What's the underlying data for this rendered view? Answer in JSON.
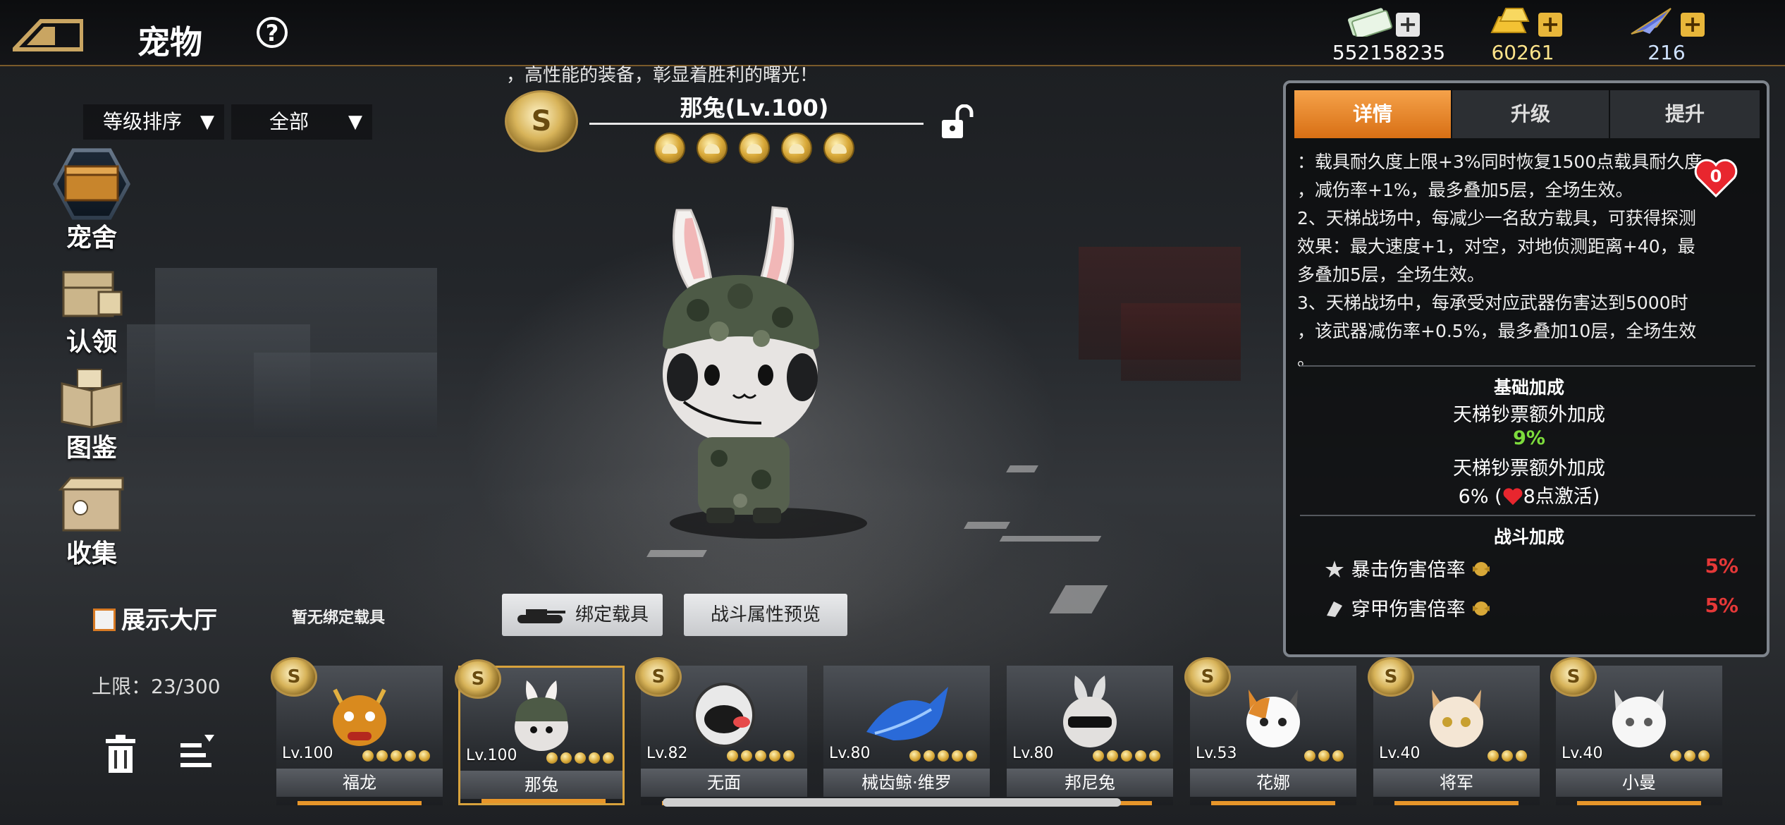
{
  "header": {
    "title": "宠物",
    "help_symbol": "?",
    "currencies": [
      {
        "icon": "cash-icon",
        "value": "552158235"
      },
      {
        "icon": "gold-bar-icon",
        "value": "60261"
      },
      {
        "icon": "fighter-jet-icon",
        "value": "216"
      }
    ],
    "plus_symbol": "+"
  },
  "filters": {
    "sort_label": "等级排序",
    "category_label": "全部",
    "arrow": "▼"
  },
  "sidenav": [
    {
      "label": "宠舍",
      "icon": "kennel-icon"
    },
    {
      "label": "认领",
      "icon": "claim-crate-icon"
    },
    {
      "label": "图鉴",
      "icon": "book-icon"
    },
    {
      "label": "收集",
      "icon": "collection-box-icon"
    }
  ],
  "pet": {
    "description": "，高性能的装备，彰显着胜利的曙光！",
    "name": "那兔(Lv.100)",
    "rank_symbol": "S",
    "stars": 5
  },
  "panel": {
    "tabs": [
      "详情",
      "升级",
      "提升"
    ],
    "heart_count": "0",
    "skill_lines": [
      "：载具耐久度上限+3%同时恢复1500点载具耐久度",
      "，减伤率+1%，最多叠加5层，全场生效。",
      "2、天梯战场中，每减少一名敌方载具，可获得探测",
      "效果：最大速度+1，对空，对地侦测距离+40，最",
      "多叠加5层，全场生效。",
      "3、天梯战场中，每承受对应武器伤害达到5000时",
      "，该武器减伤率+0.5%，最多叠加10层，全场生效",
      "。"
    ],
    "base_bonus": {
      "title": "基础加成",
      "line1_label": "天梯钞票额外加成",
      "line1_value": "9%",
      "line2_label": "天梯钞票额外加成",
      "line2_value": "6% (",
      "line2_suffix": "8点激活)"
    },
    "combat_bonus": {
      "title": "战斗加成",
      "rows": [
        {
          "label": "暴击伤害倍率",
          "value": "5%"
        },
        {
          "label": "穿甲伤害倍率",
          "value": "5%"
        }
      ]
    }
  },
  "actions": {
    "no_vehicle": "暂无绑定载具",
    "bind_vehicle": "绑定载具",
    "preview": "战斗属性预览",
    "showroom": "展示大厅",
    "limit": "上限：23/300"
  },
  "pets": [
    {
      "name": "福龙",
      "level": "Lv.100",
      "stars": 5,
      "selected": false,
      "medal": "S"
    },
    {
      "name": "那兔",
      "level": "Lv.100",
      "stars": 5,
      "selected": true,
      "medal": "S"
    },
    {
      "name": "无面",
      "level": "Lv.82",
      "stars": 5,
      "selected": false,
      "medal": "S"
    },
    {
      "name": "械齿鲸·维罗",
      "level": "Lv.80",
      "stars": 5,
      "selected": false,
      "medal": ""
    },
    {
      "name": "邦尼兔",
      "level": "Lv.80",
      "stars": 5,
      "selected": false,
      "medal": ""
    },
    {
      "name": "花娜",
      "level": "Lv.53",
      "stars": 3,
      "selected": false,
      "medal": "S"
    },
    {
      "name": "将军",
      "level": "Lv.40",
      "stars": 3,
      "selected": false,
      "medal": "S"
    },
    {
      "name": "小曼",
      "level": "Lv.40",
      "stars": 3,
      "selected": false,
      "medal": "S"
    }
  ]
}
